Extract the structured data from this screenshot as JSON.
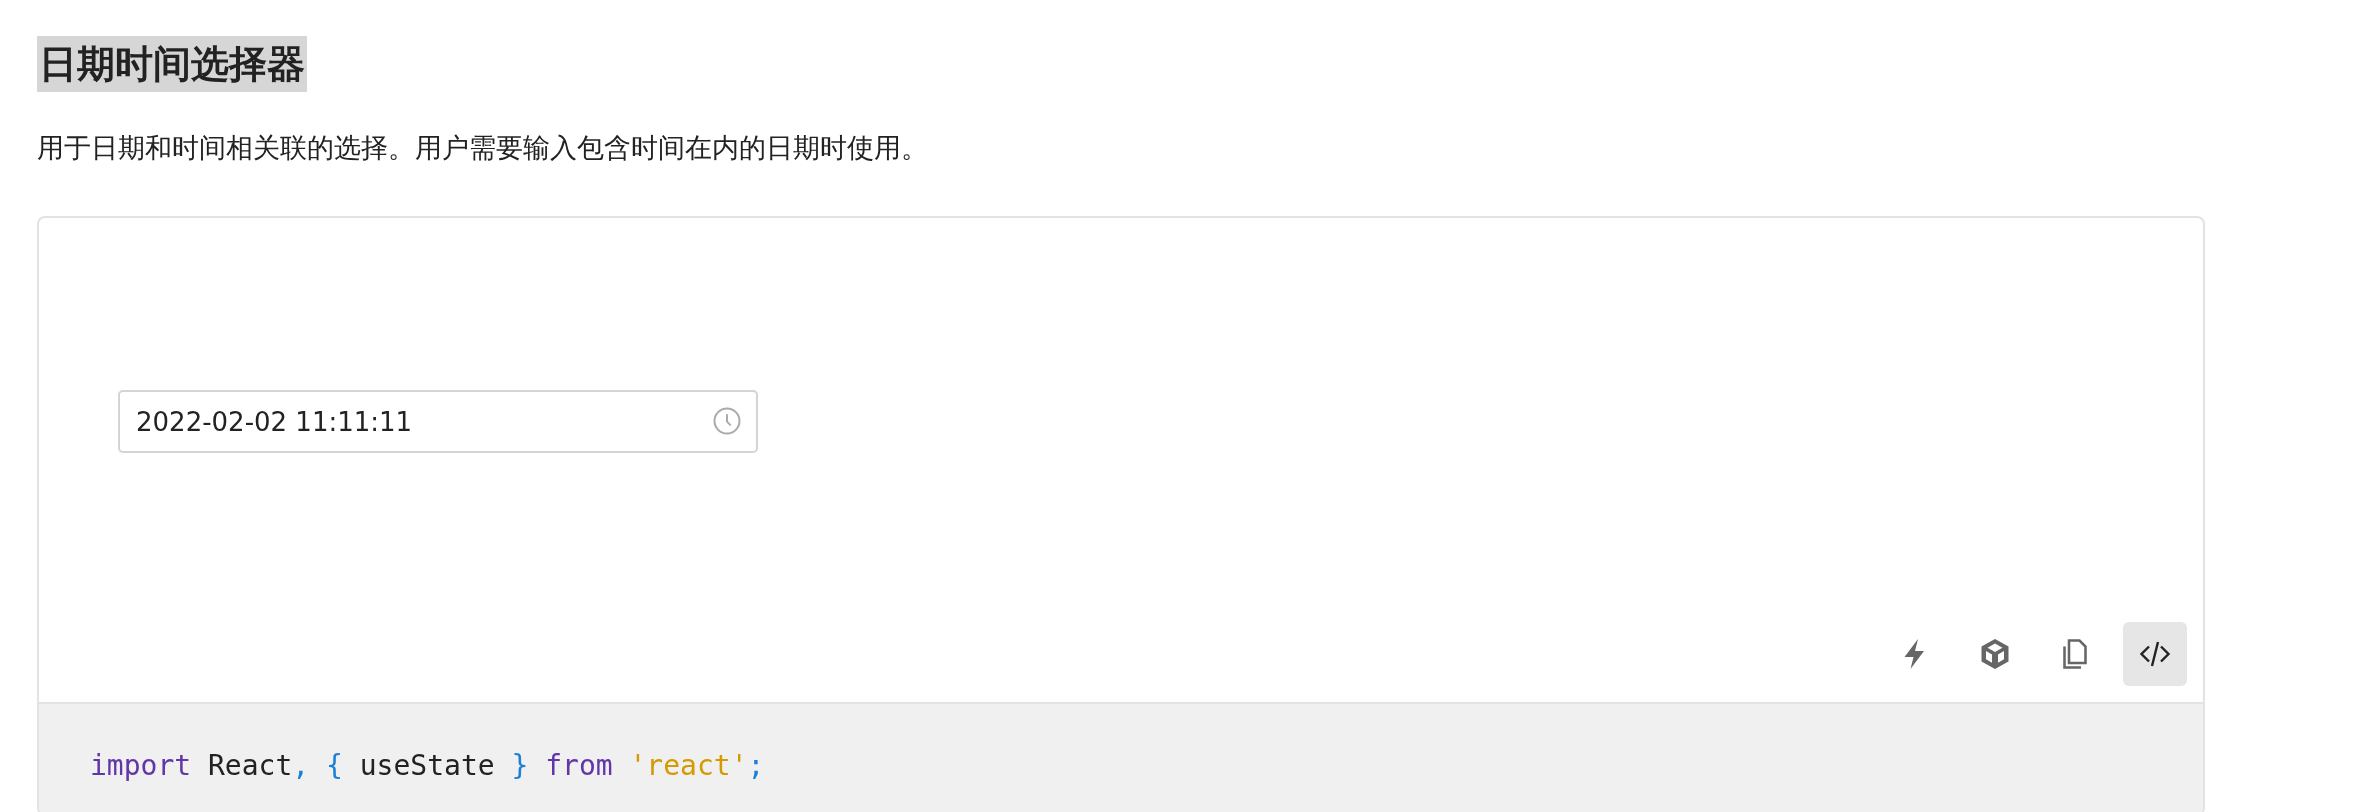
{
  "title": "日期时间选择器",
  "description": "用于日期和时间相关联的选择。用户需要输入包含时间在内的日期时使用。",
  "demo": {
    "datetime_field": {
      "value": "2022-02-02 11:11:11"
    },
    "toolbar": [
      {
        "kind": "bolt",
        "selected": false
      },
      {
        "kind": "cube",
        "selected": false
      },
      {
        "kind": "copy",
        "selected": false
      },
      {
        "kind": "code",
        "selected": true
      }
    ]
  },
  "code_lines": [
    [
      {
        "kind": "keyword",
        "text": "import"
      },
      {
        "kind": "plain",
        "text": " React"
      },
      {
        "kind": "punct",
        "text": ", {"
      },
      {
        "kind": "plain",
        "text": " useState "
      },
      {
        "kind": "punct",
        "text": "}"
      },
      {
        "kind": "keyword",
        "text": " from"
      },
      {
        "kind": "string",
        "text": " 'react'"
      },
      {
        "kind": "punct",
        "text": ";"
      }
    ]
  ]
}
